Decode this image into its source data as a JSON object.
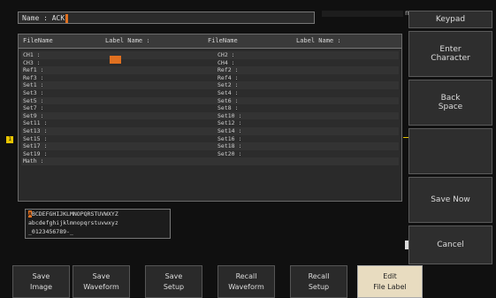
{
  "name_bar": {
    "label": "Name : ACK"
  },
  "top_right_indicator": "n",
  "file_table": {
    "headers": [
      "FileName",
      "Label Name :",
      "FileName",
      "Label Name :"
    ],
    "rows": [
      [
        "CH1 :",
        "CH2 :"
      ],
      [
        "CH3 :",
        "CH4 :"
      ],
      [
        "Ref1 :",
        "Ref2 :"
      ],
      [
        "Ref3 :",
        "Ref4 :"
      ],
      [
        "Set1 :",
        "Set2 :"
      ],
      [
        "Set3 :",
        "Set4 :"
      ],
      [
        "Set5 :",
        "Set6 :"
      ],
      [
        "Set7 :",
        "Set8 :"
      ],
      [
        "Set9 :",
        "Set10 :"
      ],
      [
        "Set11 :",
        "Set12 :"
      ],
      [
        "Set13 :",
        "Set14 :"
      ],
      [
        "Set15 :",
        "Set16 :"
      ],
      [
        "Set17 :",
        "Set18 :"
      ],
      [
        "Set19 :",
        "Set20 :"
      ],
      [
        "Math :",
        ""
      ]
    ]
  },
  "character_set": {
    "line1_selected": "A",
    "line1_rest": "BCDEFGHIJKLMNOPQRSTUVWXYZ",
    "line2": "abcdefghijklmnopqrstuvwxyz",
    "line3": "_0123456789-_"
  },
  "channel_marker": "1",
  "side_panel": {
    "keypad": "Keypad",
    "enter_character": [
      "Enter",
      "Character"
    ],
    "back_space": [
      "Back",
      "Space"
    ],
    "empty": "",
    "save_now": "Save Now",
    "cancel": "Cancel"
  },
  "bottom_menu": [
    [
      "Save",
      "Image"
    ],
    [
      "Save",
      "Waveform"
    ],
    [
      "Save",
      "Setup"
    ],
    [
      "Recall",
      "Waveform"
    ],
    [
      "Recall",
      "Setup"
    ],
    [
      "Edit",
      "File Label"
    ]
  ]
}
